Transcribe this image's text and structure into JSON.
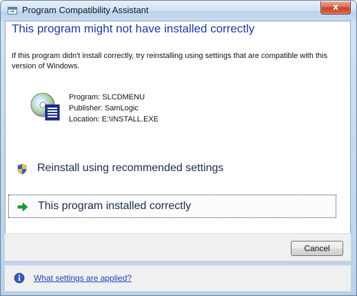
{
  "window": {
    "title": "Program Compatibility Assistant",
    "close_glyph": "x"
  },
  "main": {
    "heading": "This program might not have installed correctly",
    "description": "If this program didn't install correctly, try reinstalling using settings that are compatible with this version of Windows.",
    "program_info": {
      "program": "Program: SLCDMENU",
      "publisher": "Publisher: SamLogic",
      "location": "Location: E:\\INSTALL.EXE"
    },
    "options": [
      {
        "label": "Reinstall using recommended settings",
        "icon": "shield-icon"
      },
      {
        "label": "This program installed correctly",
        "icon": "green-arrow-icon"
      }
    ]
  },
  "footer": {
    "cancel_label": "Cancel"
  },
  "help": {
    "link_label": "What settings are applied?",
    "icon": "info-icon"
  },
  "colors": {
    "heading": "#1d3aa6",
    "link": "#1d46b8",
    "arrow": "#1f9e2e"
  }
}
